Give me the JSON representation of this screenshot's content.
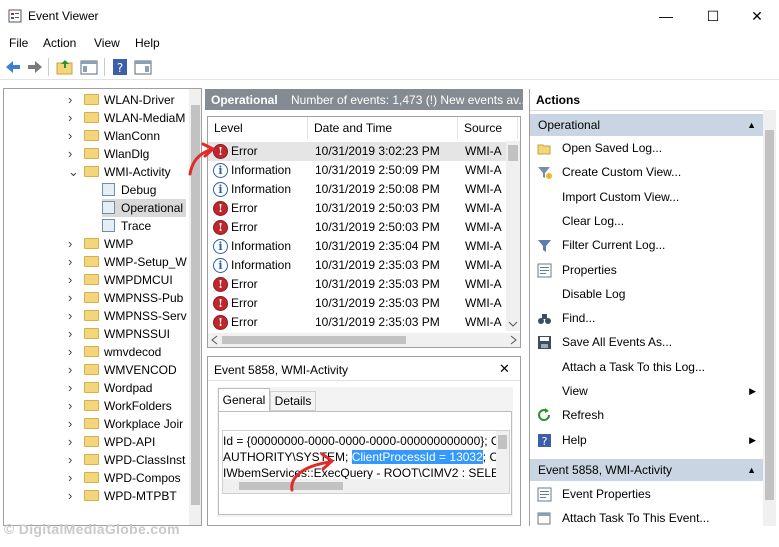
{
  "window": {
    "title": "Event Viewer",
    "minimize": "—",
    "maximize": "☐",
    "close": "✕"
  },
  "menu": [
    "File",
    "Action",
    "View",
    "Help"
  ],
  "tree": {
    "items": [
      {
        "label": "WLAN-Driver",
        "kind": "folder",
        "chevron": "›"
      },
      {
        "label": "WLAN-MediaM",
        "kind": "folder",
        "chevron": "›"
      },
      {
        "label": "WlanConn",
        "kind": "folder",
        "chevron": "›"
      },
      {
        "label": "WlanDlg",
        "kind": "folder",
        "chevron": "›"
      },
      {
        "label": "WMI-Activity",
        "kind": "folder",
        "chevron": "⌄"
      },
      {
        "label": "Debug",
        "kind": "log",
        "chevron": ""
      },
      {
        "label": "Operational",
        "kind": "log",
        "chevron": "",
        "selected": true
      },
      {
        "label": "Trace",
        "kind": "log",
        "chevron": ""
      },
      {
        "label": "WMP",
        "kind": "folder",
        "chevron": "›"
      },
      {
        "label": "WMP-Setup_W",
        "kind": "folder",
        "chevron": "›"
      },
      {
        "label": "WMPDMCUI",
        "kind": "folder",
        "chevron": "›"
      },
      {
        "label": "WMPNSS-Pub",
        "kind": "folder",
        "chevron": "›"
      },
      {
        "label": "WMPNSS-Serv",
        "kind": "folder",
        "chevron": "›"
      },
      {
        "label": "WMPNSSUI",
        "kind": "folder",
        "chevron": "›"
      },
      {
        "label": "wmvdecod",
        "kind": "folder",
        "chevron": "›"
      },
      {
        "label": "WMVENCOD",
        "kind": "folder",
        "chevron": "›"
      },
      {
        "label": "Wordpad",
        "kind": "folder",
        "chevron": "›"
      },
      {
        "label": "WorkFolders",
        "kind": "folder",
        "chevron": "›"
      },
      {
        "label": "Workplace Joir",
        "kind": "folder",
        "chevron": "›"
      },
      {
        "label": "WPD-API",
        "kind": "folder",
        "chevron": "›"
      },
      {
        "label": "WPD-ClassInst",
        "kind": "folder",
        "chevron": "›"
      },
      {
        "label": "WPD-Compos",
        "kind": "folder",
        "chevron": "›"
      },
      {
        "label": "WPD-MTPBT",
        "kind": "folder",
        "chevron": "›"
      }
    ]
  },
  "events": {
    "header_title": "Operational",
    "header_info": "Number of events: 1,473 (!) New events av...",
    "columns": [
      "Level",
      "Date and Time",
      "Source"
    ],
    "rows": [
      {
        "level": "Error",
        "type": "error",
        "date": "10/31/2019 3:02:23 PM",
        "source": "WMI-A",
        "selected": true
      },
      {
        "level": "Information",
        "type": "info",
        "date": "10/31/2019 2:50:09 PM",
        "source": "WMI-A"
      },
      {
        "level": "Information",
        "type": "info",
        "date": "10/31/2019 2:50:08 PM",
        "source": "WMI-A"
      },
      {
        "level": "Error",
        "type": "error",
        "date": "10/31/2019 2:50:03 PM",
        "source": "WMI-A"
      },
      {
        "level": "Error",
        "type": "error",
        "date": "10/31/2019 2:50:03 PM",
        "source": "WMI-A"
      },
      {
        "level": "Information",
        "type": "info",
        "date": "10/31/2019 2:35:04 PM",
        "source": "WMI-A"
      },
      {
        "level": "Information",
        "type": "info",
        "date": "10/31/2019 2:35:03 PM",
        "source": "WMI-A"
      },
      {
        "level": "Error",
        "type": "error",
        "date": "10/31/2019 2:35:03 PM",
        "source": "WMI-A"
      },
      {
        "level": "Error",
        "type": "error",
        "date": "10/31/2019 2:35:03 PM",
        "source": "WMI-A"
      },
      {
        "level": "Error",
        "type": "error",
        "date": "10/31/2019 2:35:03 PM",
        "source": "WMI-A"
      }
    ]
  },
  "detail": {
    "title": "Event 5858, WMI-Activity",
    "close": "✕",
    "tabs": [
      "General",
      "Details"
    ],
    "line1": "Id = {00000000-0000-0000-0000-000000000000}; Clie",
    "line2_pre": "AUTHORITY\\SYSTEM; ",
    "line2_highlight": "ClientProcessId = 13032",
    "line2_post": "; Com",
    "line3": "IWbemServices::ExecQuery - ROOT\\CIMV2 : SELECT"
  },
  "actions": {
    "title": "Actions",
    "section1": "Operational",
    "items1": [
      {
        "label": "Open Saved Log...",
        "icon": "folder-open-icon"
      },
      {
        "label": "Create Custom View...",
        "icon": "filter-star-icon"
      },
      {
        "label": "Import Custom View...",
        "icon": ""
      },
      {
        "label": "Clear Log...",
        "icon": ""
      },
      {
        "label": "Filter Current Log...",
        "icon": "filter-icon"
      },
      {
        "label": "Properties",
        "icon": "properties-icon"
      },
      {
        "label": "Disable Log",
        "icon": ""
      },
      {
        "label": "Find...",
        "icon": "binoculars-icon"
      },
      {
        "label": "Save All Events As...",
        "icon": "save-icon"
      },
      {
        "label": "Attach a Task To this Log...",
        "icon": ""
      },
      {
        "label": "View",
        "icon": "",
        "submenu": true
      },
      {
        "label": "Refresh",
        "icon": "refresh-icon"
      },
      {
        "label": "Help",
        "icon": "help-icon",
        "submenu": true
      }
    ],
    "section2": "Event 5858, WMI-Activity",
    "items2": [
      {
        "label": "Event Properties",
        "icon": "properties-icon"
      },
      {
        "label": "Attach Task To This Event...",
        "icon": "task-icon"
      }
    ]
  },
  "watermark": "© DigitalMediaGlobe.com"
}
